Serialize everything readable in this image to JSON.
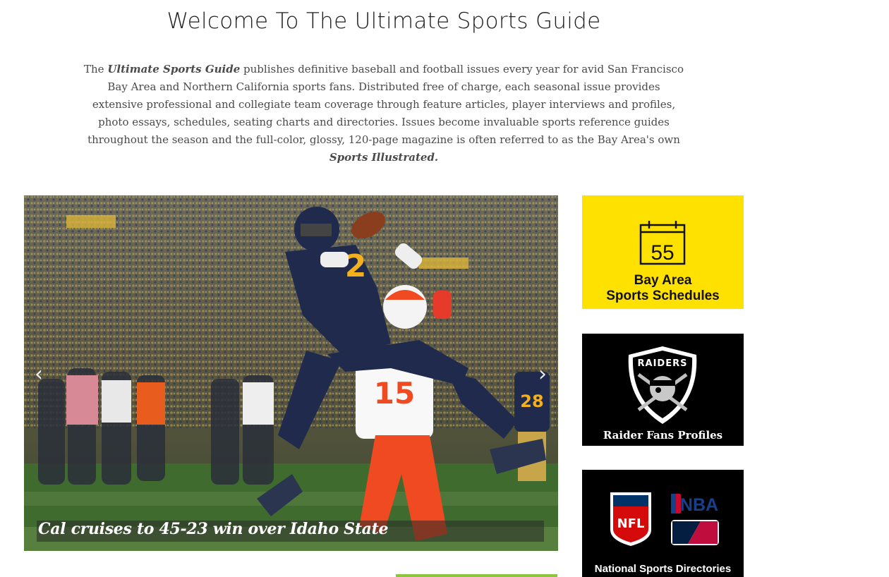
{
  "header": {
    "title": "Welcome To The Ultimate Sports Guide"
  },
  "intro": {
    "lead": "The ",
    "brand": "Ultimate Sports Guide",
    "body": " publishes definitive baseball and football issues every year for avid San Francisco Bay Area and Northern California sports fans. Distributed free of charge, each seasonal issue provides extensive professional and collegiate team coverage through feature articles, player interviews and profiles, photo essays, schedules, seating charts and directories. Issues become invaluable sports reference guides throughout the season and the full-color, glossy, 120-page magazine is often referred to as the Bay Area's own ",
    "magazine": "Sports Illustrated."
  },
  "carousel": {
    "caption": "Cal cruises to 45-23 win over Idaho State",
    "prev_glyph": "‹",
    "next_glyph": "›",
    "jersey_front": "2",
    "jersey_back": "15",
    "jersey_sideline": "28"
  },
  "tiles": {
    "schedules": {
      "calendar_number": "55",
      "line1": "Bay Area",
      "line2": "Sports Schedules",
      "bg": "#ffe100"
    },
    "raiders": {
      "shield_text": "RAIDERS",
      "label": "Raider Fans Profiles",
      "bg": "#000000"
    },
    "directories": {
      "nfl_text": "NFL",
      "nba_text": "NBA",
      "label": "National Sports Directories",
      "bg": "#000000"
    }
  },
  "colors": {
    "accent_green": "#8cc63f",
    "schedules_yellow": "#ffe100",
    "cal_navy": "#1f2a4d",
    "cal_gold": "#f2b01e",
    "opponent_orange": "#f04a23"
  }
}
